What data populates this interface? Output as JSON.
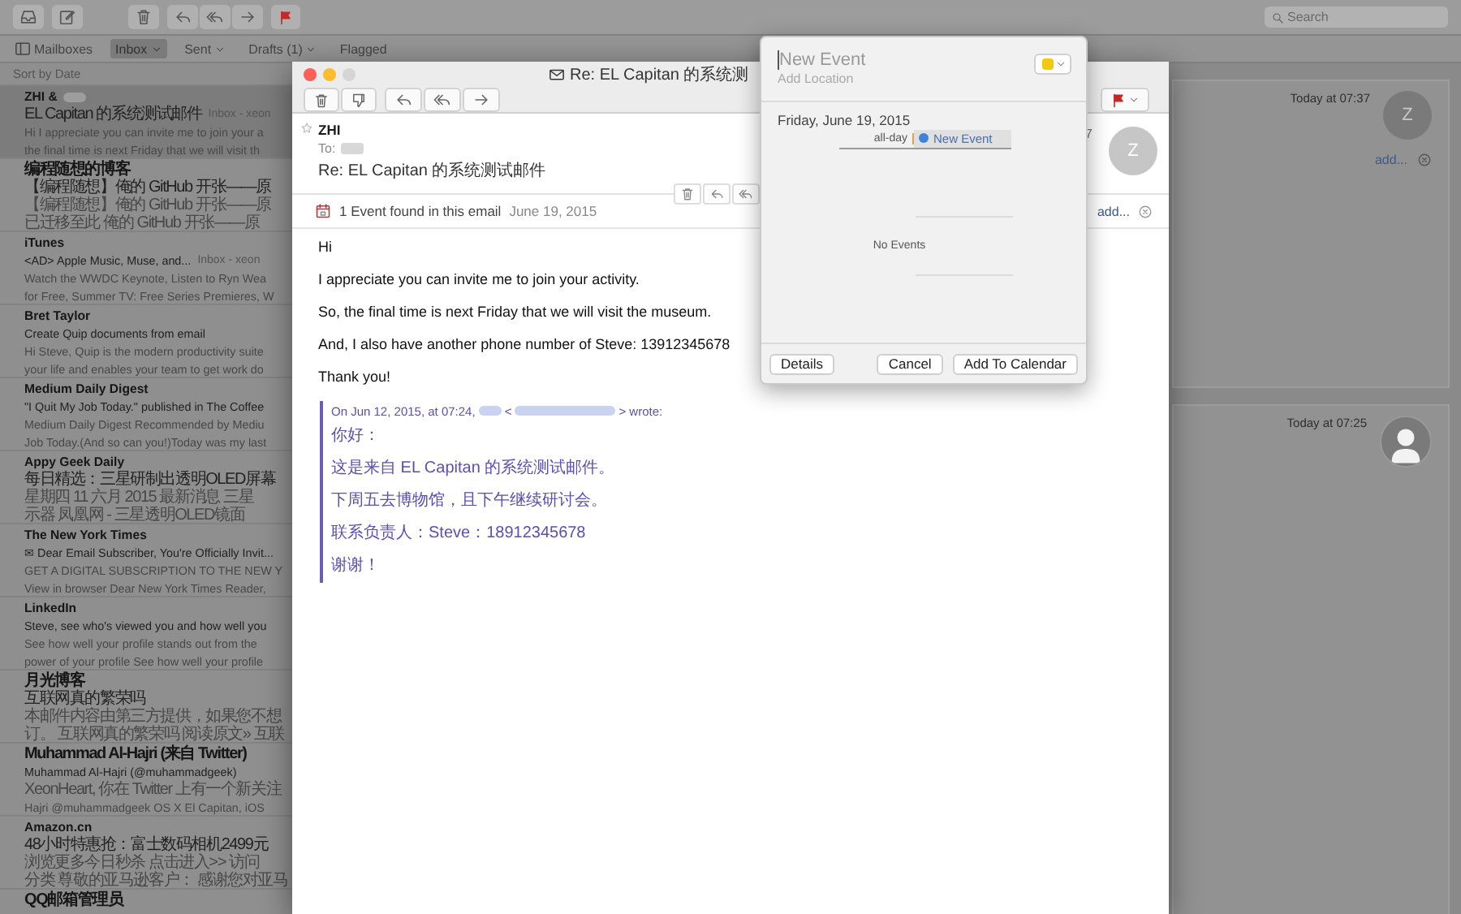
{
  "main_toolbar": {
    "search": {
      "placeholder": "Search"
    }
  },
  "favorites_bar": [
    {
      "label": "Mailboxes",
      "selected": false,
      "kind": "sidebar"
    },
    {
      "label": "Inbox",
      "selected": true,
      "kind": "menu"
    },
    {
      "label": "Sent",
      "selected": false,
      "kind": "menu"
    },
    {
      "label": "Drafts (1)",
      "selected": false,
      "kind": "menu"
    },
    {
      "label": "Flagged",
      "selected": false,
      "kind": "plain"
    }
  ],
  "sort": "Sort by Date",
  "messages": [
    {
      "sender": "ZHI &",
      "sender_blurred": true,
      "subject": "EL Capitan 的系统测试邮件",
      "mailbox": "Inbox - xeon",
      "preview": [
        "Hi I appreciate you can invite me to join your a",
        "the final time is next Friday that we will visit th"
      ],
      "selected": true
    },
    {
      "sender": "编程随想的博客",
      "subject": "【编程随想】俺的 GitHub 开张——原",
      "preview": [
        "【编程随想】俺的 GitHub 开张——原",
        "已迁移至此 俺的 GitHub 开张——原"
      ],
      "selected": false
    },
    {
      "sender": "iTunes",
      "subject": "<AD> Apple Music, Muse, and...",
      "mailbox": "Inbox - xeon",
      "preview": [
        "Watch the WWDC Keynote, Listen to Ryn Wea",
        "for Free, Summer TV: Free Series Premieres, W"
      ],
      "selected": false
    },
    {
      "sender": "Bret Taylor",
      "subject": "Create Quip documents from email",
      "preview": [
        "Hi Steve, Quip is the modern productivity suite",
        "your life and enables your team to get work do"
      ],
      "selected": false
    },
    {
      "sender": "Medium Daily Digest",
      "subject": "\"I Quit My Job Today.\" published in The Coffee",
      "preview": [
        "Medium Daily Digest Recommended by Mediu",
        "Job Today.(And so can you!)Today was my last"
      ],
      "selected": false
    },
    {
      "sender": "Appy Geek Daily",
      "subject": "每日精选：三星研制出透明OLED屏幕",
      "preview": [
        "星期四 11 六月 2015 最新消息 三星",
        "示器 凤凰网 - 三星透明OLED镜面"
      ],
      "selected": false
    },
    {
      "sender": "The New York Times",
      "subject": "✉ Dear Email Subscriber, You're Officially Invit...",
      "preview": [
        "GET A DIGITAL SUBSCRIPTION TO THE NEW Y",
        "View in browser Dear New York Times Reader,"
      ],
      "selected": false
    },
    {
      "sender": "LinkedIn",
      "subject": "Steve, see who's viewed you and how well you",
      "preview": [
        "See how well your profile stands out from the",
        "power of your profile See how well your profile"
      ],
      "selected": false
    },
    {
      "sender": "月光博客",
      "subject": "互联网真的繁荣吗",
      "preview": [
        "本邮件内容由第三方提供，如果您不想",
        "订。 互联网真的繁荣吗 阅读原文» 互联"
      ],
      "selected": false
    },
    {
      "sender": "Muhammad Al-Hajri (来自 Twitter)",
      "subject": "Muhammad Al-Hajri (@muhammadgeek)",
      "preview": [
        "XeonHeart, 你在 Twitter 上有一个新关注",
        "Hajri @muhammadgeek OS X El Capitan, iOS"
      ],
      "selected": false
    },
    {
      "sender": "Amazon.cn",
      "subject": "48小时特惠抢：富士数码相机2499元",
      "preview": [
        "浏览更多今日秒杀 点击进入>> 访问",
        "分类 尊敬的亚马逊客户： 感谢您对亚马"
      ],
      "selected": false
    },
    {
      "sender": "QQ邮箱管理员",
      "selected": false
    }
  ],
  "conversation_cards": [
    {
      "time": "Today at 07:37",
      "avatar": "Z",
      "action": "add..."
    },
    {
      "time": "Today at 07:25"
    }
  ],
  "message_window": {
    "title": "Re: EL Capitan 的系统测",
    "from": "ZHI",
    "to_label": "To:",
    "subject": "Re: EL Capitan 的系统测试邮件",
    "time": "7",
    "avatar": "Z",
    "event_banner": {
      "text": "1 Event found in this email",
      "date": "June 19, 2015",
      "action": "add..."
    },
    "body": [
      "Hi",
      "I appreciate you can invite me to join your activity.",
      "So, the final time is next Friday that we will visit the museum.",
      "And, I also have another phone number of Steve: 13912345678",
      "Thank you!"
    ],
    "quote": {
      "attribution_start": "On Jun 12, 2015, at 07:24,",
      "bracket_open": "<",
      "attribution_end": "> wrote:",
      "lines": [
        "你好：",
        "这是来自 EL Capitan 的系统测试邮件。",
        "下周五去博物馆，且下午继续研讨会。",
        "联系负责人：Steve：18912345678",
        "谢谢！"
      ]
    }
  },
  "event_popover": {
    "title_placeholder": "New Event",
    "location_placeholder": "Add Location",
    "date": "Friday, June 19, 2015",
    "all_day_label": "all-day",
    "event_chip": "New Event",
    "empty": "No Events",
    "buttons": [
      "Details",
      "Cancel",
      "Add To Calendar"
    ]
  }
}
